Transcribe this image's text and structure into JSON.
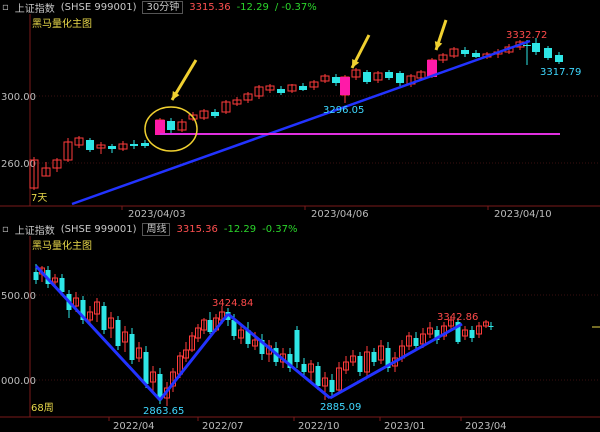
{
  "top_panel": {
    "title": "上证指数",
    "code": "(SHSE 999001)",
    "period": "30分钟",
    "price": "3315.36",
    "change": "-12.29",
    "change_pct": "/ -0.37%",
    "study": "黑马量化主图",
    "y_labels": [
      "300.00",
      "260.00"
    ],
    "x_labels": [
      "2023/04/03",
      "2023/04/06",
      "2023/04/10"
    ],
    "corner_label": "7天",
    "annotations": [
      "3332.72",
      "3296.05",
      "3317.79"
    ],
    "colors": {
      "up": "#ff3b3b",
      "down": "#2ee6e6",
      "trend": "#2233ff",
      "hline": "#e030e0",
      "arrow": "#f0d030",
      "circle": "#f0d030"
    }
  },
  "bottom_panel": {
    "title": "上证指数",
    "code": "(SHSE 999001)",
    "period": "周线",
    "price": "3315.36",
    "change": "-12.29",
    "change_pct": "-0.37%",
    "study": "黑马量化主图",
    "y_labels": [
      "500.00",
      "000.00"
    ],
    "x_labels": [
      "2022/04",
      "2022/07",
      "2022/10",
      "2023/01",
      "2023/04"
    ],
    "corner_label": "68周",
    "annotations": [
      "3424.84",
      "2863.65",
      "2885.09",
      "3342.86"
    ]
  }
}
